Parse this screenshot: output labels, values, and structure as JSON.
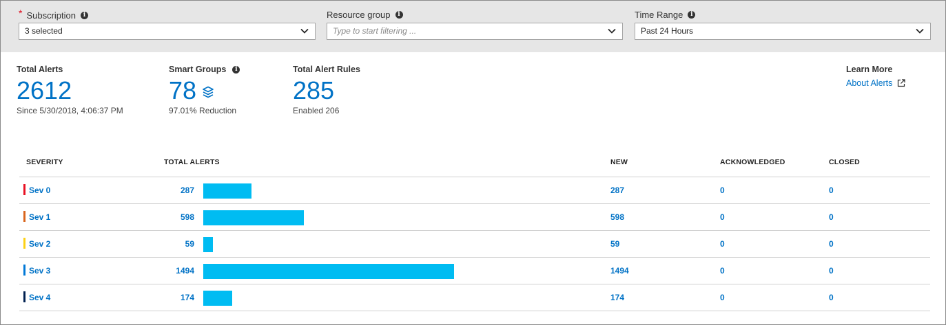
{
  "filters": {
    "subscription": {
      "label": "Subscription",
      "value": "3 selected",
      "required": true
    },
    "resource_group": {
      "label": "Resource group",
      "value": "",
      "placeholder": "Type to start filtering ..."
    },
    "time_range": {
      "label": "Time Range",
      "value": "Past 24 Hours"
    }
  },
  "stats": {
    "total_alerts": {
      "title": "Total Alerts",
      "value": "2612",
      "sub": "Since 5/30/2018, 4:06:37 PM"
    },
    "smart_groups": {
      "title": "Smart Groups",
      "value": "78",
      "sub": "97.01% Reduction"
    },
    "total_alert_rules": {
      "title": "Total Alert Rules",
      "value": "285",
      "sub": "Enabled 206"
    },
    "learn_more": {
      "title": "Learn More",
      "link": "About Alerts"
    }
  },
  "table": {
    "headers": [
      "SEVERITY",
      "TOTAL ALERTS",
      "NEW",
      "ACKNOWLEDGED",
      "CLOSED"
    ],
    "rows": [
      {
        "severity": "Sev 0",
        "total": "287",
        "new": "287",
        "acknowledged": "0",
        "closed": "0",
        "color": "#e81123"
      },
      {
        "severity": "Sev 1",
        "total": "598",
        "new": "598",
        "acknowledged": "0",
        "closed": "0",
        "color": "#d9651d"
      },
      {
        "severity": "Sev 2",
        "total": "59",
        "new": "59",
        "acknowledged": "0",
        "closed": "0",
        "color": "#fcd116"
      },
      {
        "severity": "Sev 3",
        "total": "1494",
        "new": "1494",
        "acknowledged": "0",
        "closed": "0",
        "color": "#0078d7"
      },
      {
        "severity": "Sev 4",
        "total": "174",
        "new": "174",
        "acknowledged": "0",
        "closed": "0",
        "color": "#002050"
      }
    ]
  },
  "colors": {
    "accent": "#0072c6",
    "bar": "#00bcf2",
    "filter_bg": "#e6e6e6"
  }
}
